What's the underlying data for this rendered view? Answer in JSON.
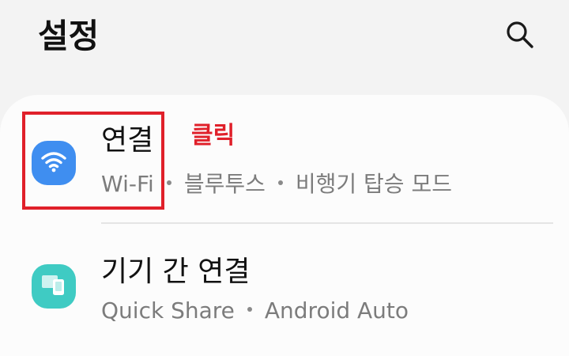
{
  "header": {
    "title": "설정",
    "search_icon": "search-icon"
  },
  "items": [
    {
      "title": "연결",
      "subtitle_parts": [
        "Wi-Fi",
        "블루투스",
        "비행기 탑승 모드"
      ],
      "icon": "wifi-icon",
      "icon_color": "#3f8ef0"
    },
    {
      "title": "기기 간 연결",
      "subtitle_parts": [
        "Quick Share",
        "Android Auto"
      ],
      "icon": "devices-icon",
      "icon_color": "#3fcbc3"
    }
  ],
  "annotation": {
    "label": "클릭",
    "color": "#e0202a"
  }
}
